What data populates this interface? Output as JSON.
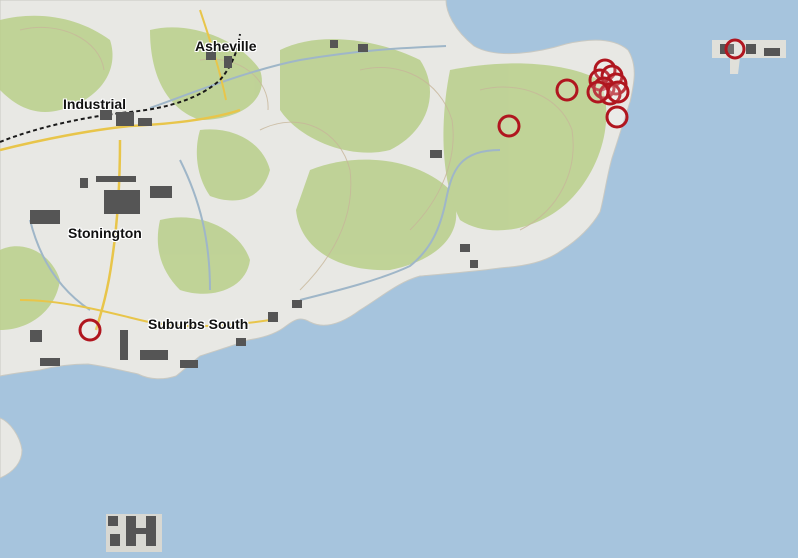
{
  "map": {
    "town_labels": [
      "Asheville",
      "Industrial",
      "Stonington",
      "Suburbs South"
    ],
    "colors": {
      "water": "#a6c4dd",
      "land": "#e8e8e4",
      "forest": "#b9cf8a",
      "road_primary": "#e8c54a",
      "road_secondary": "#9fb6c8",
      "railway": "#1a1a1a",
      "building": "#555555",
      "marker": "#b0161f"
    },
    "markers": [
      {
        "name": "marker-suburbs-south"
      },
      {
        "name": "marker-east-1"
      },
      {
        "name": "marker-east-2"
      },
      {
        "name": "marker-east-cluster-1"
      },
      {
        "name": "marker-east-cluster-2"
      },
      {
        "name": "marker-east-cluster-3"
      },
      {
        "name": "marker-east-cluster-4"
      },
      {
        "name": "marker-east-cluster-5"
      },
      {
        "name": "marker-east-cluster-6"
      },
      {
        "name": "marker-east-cluster-7"
      },
      {
        "name": "marker-east-cluster-8"
      },
      {
        "name": "marker-east-9"
      },
      {
        "name": "marker-northeast-island"
      }
    ]
  }
}
